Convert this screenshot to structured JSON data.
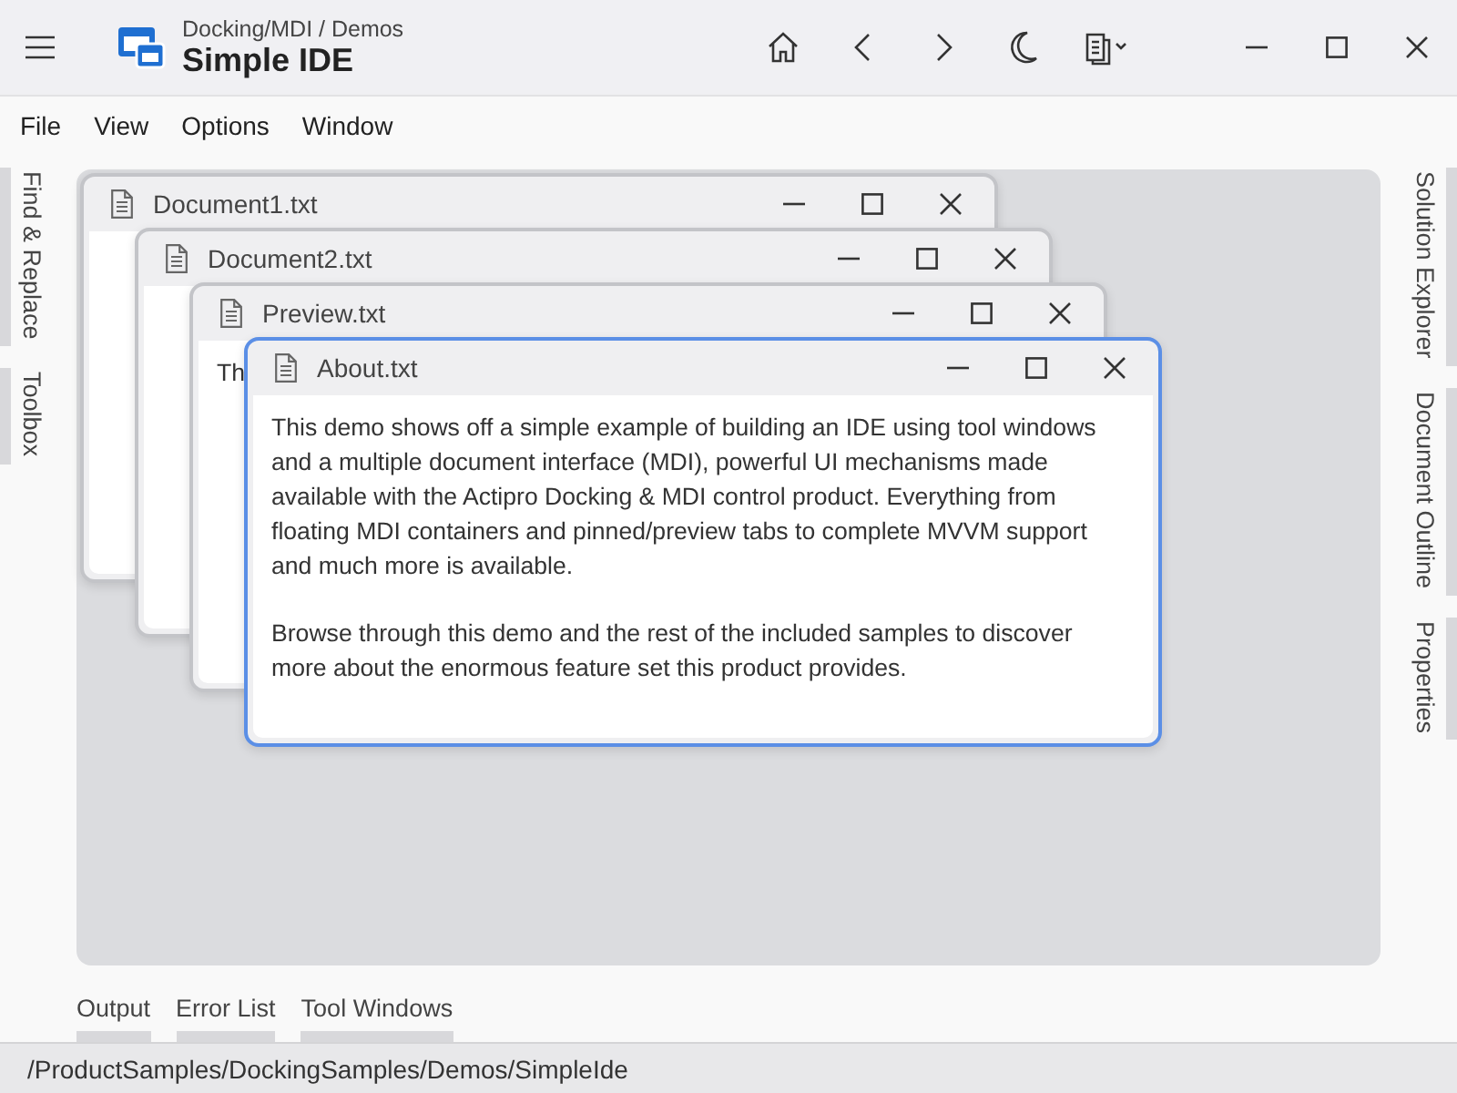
{
  "title_bar": {
    "breadcrumb": "Docking/MDI / Demos",
    "title": "Simple IDE"
  },
  "menu": [
    "File",
    "View",
    "Options",
    "Window"
  ],
  "left_tabs": [
    {
      "label": "Find & Replace"
    },
    {
      "label": "Toolbox"
    }
  ],
  "right_tabs": [
    {
      "label": "Solution Explorer"
    },
    {
      "label": "Document Outline"
    },
    {
      "label": "Properties"
    }
  ],
  "documents": [
    {
      "title": "Document1.txt",
      "active": false
    },
    {
      "title": "Document2.txt",
      "active": false
    },
    {
      "title": "Preview.txt",
      "active": false,
      "paragraphs": [
        "Th"
      ]
    },
    {
      "title": "About.txt",
      "active": true,
      "paragraphs": [
        "This demo shows off a simple example of building an IDE using tool windows and a multiple document interface (MDI), powerful UI mechanisms made available with the Actipro Docking & MDI control product. Everything from floating MDI containers and pinned/preview tabs to complete MVVM support and much more is available.",
        "Browse through this demo and the rest of the included samples to discover more about the enormous feature set this product provides."
      ]
    }
  ],
  "bottom_tabs": [
    {
      "label": "Output"
    },
    {
      "label": "Error List"
    },
    {
      "label": "Tool Windows"
    }
  ],
  "status_bar": {
    "path": "/ProductSamples/DockingSamples/Demos/SimpleIde"
  }
}
